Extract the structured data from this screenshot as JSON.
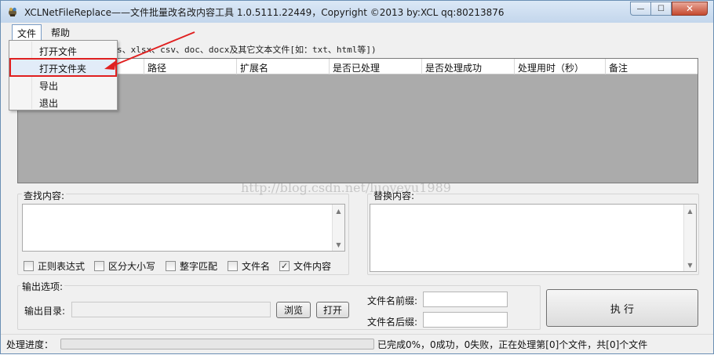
{
  "window": {
    "title": "XCLNetFileReplace——文件批量改名改内容工具  1.0.5111.22449，Copyright ©2013 by:XCL qq:80213876",
    "app_icon": "xcl-app-icon"
  },
  "menubar": {
    "file": "文件",
    "help": "帮助"
  },
  "file_menu": {
    "items": [
      "打开文件",
      "打开文件夹",
      "导出",
      "退出"
    ],
    "highlighted": "打开文件夹"
  },
  "filter_hint": "s、xlsx、csv、doc、docx及其它文本文件[如：txt、html等])",
  "grid": {
    "columns": [
      "路径",
      "扩展名",
      "是否已处理",
      "是否处理成功",
      "处理用时（秒）",
      "备注"
    ]
  },
  "find": {
    "label": "查找内容:",
    "value": ""
  },
  "replace": {
    "label": "替换内容:",
    "value": ""
  },
  "options": [
    {
      "label": "正则表达式",
      "checked": false
    },
    {
      "label": "区分大小写",
      "checked": false
    },
    {
      "label": "整字匹配",
      "checked": false
    },
    {
      "label": "文件名",
      "checked": false
    },
    {
      "label": "文件内容",
      "checked": true
    }
  ],
  "output": {
    "section_label": "输出选项:",
    "dir_label": "输出目录:",
    "dir_value": "",
    "browse_button": "浏览",
    "open_button": "打开",
    "prefix_label": "文件名前缀:",
    "prefix_value": "",
    "suffix_label": "文件名后缀:",
    "suffix_value": ""
  },
  "execute_button": "执  行",
  "status": {
    "label": "处理进度：",
    "progress": 0,
    "text": "已完成0%，0成功，0失败，正在处理第[0]个文件，共[0]个文件"
  },
  "watermark": "http://blog.csdn.net/luoyeyu1989",
  "colors": {
    "highlight_box": "#e02020",
    "arrow": "#e02020",
    "grid_bg": "#ababab"
  }
}
